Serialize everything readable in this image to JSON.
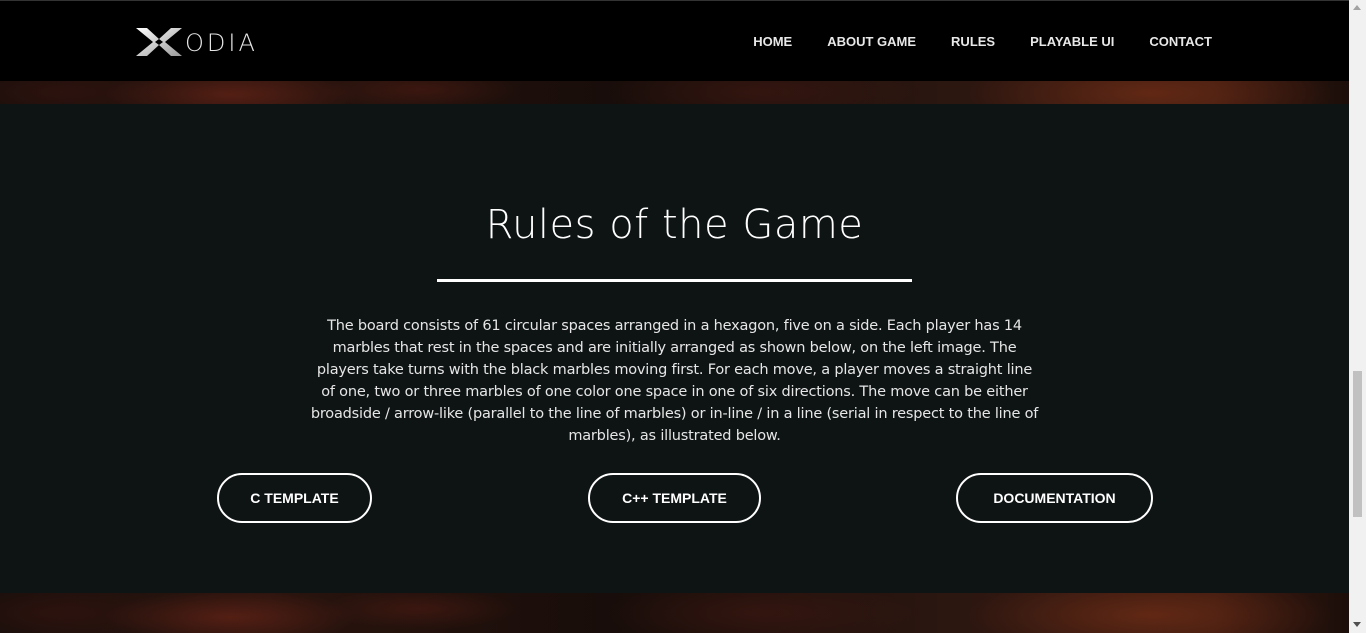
{
  "brand": {
    "logo_text": "ODIA",
    "logo_icon": "x-logo-icon"
  },
  "nav": {
    "items": [
      {
        "label": "HOME"
      },
      {
        "label": "ABOUT GAME"
      },
      {
        "label": "RULES"
      },
      {
        "label": "PLAYABLE UI"
      },
      {
        "label": "CONTACT"
      }
    ]
  },
  "rules": {
    "title": "Rules of the Game",
    "description": "The board consists of 61 circular spaces arranged in a hexagon, five on a side. Each player has 14 marbles that rest in the spaces and are initially arranged as shown below, on the left image. The players take turns with the black marbles moving first. For each move, a player moves a straight line of one, two or three marbles of one color one space in one of six directions. The move can be either broadside / arrow-like (parallel to the line of marbles) or in-line / in a line (serial in respect to the line of marbles), as illustrated below.",
    "buttons": {
      "c_template": "C TEMPLATE",
      "cpp_template": "C++ TEMPLATE",
      "documentation": "DOCUMENTATION"
    }
  },
  "colors": {
    "navbar_bg": "#000000",
    "panel_bg": "#0e1414",
    "text": "#ffffff"
  }
}
